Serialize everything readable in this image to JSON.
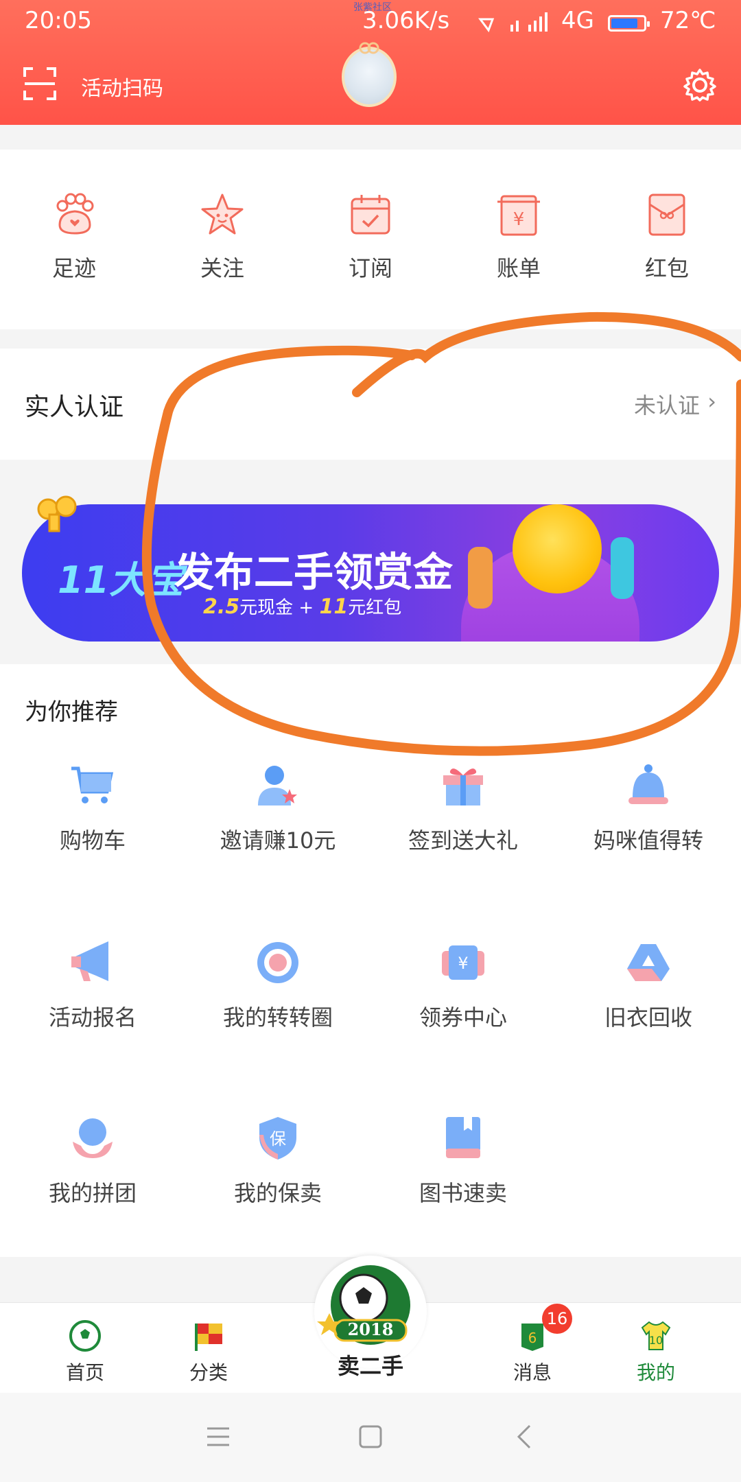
{
  "status_bar": {
    "time": "20:05",
    "speed": "3.06K/s",
    "network": "4G",
    "battery_temp": "72℃",
    "carrier_note": "张紫社区"
  },
  "header": {
    "scan_label": "活动扫码",
    "scan_icon": "scan-icon",
    "settings_icon": "gear-icon"
  },
  "shortcuts": [
    {
      "label": "足迹",
      "icon": "paw-icon"
    },
    {
      "label": "关注",
      "icon": "star-icon"
    },
    {
      "label": "订阅",
      "icon": "calendar-icon"
    },
    {
      "label": "账单",
      "icon": "bill-icon"
    },
    {
      "label": "红包",
      "icon": "red-envelope-icon"
    }
  ],
  "verify": {
    "title": "实人认证",
    "status": "未认证",
    "chevron": "›"
  },
  "banner": {
    "brand": "11大宝",
    "title": "发布二手领赏金",
    "sub_cash_amount": "2.5",
    "sub_cash_text": "元现金 +",
    "sub_red_amount": "11",
    "sub_red_text": "元红包"
  },
  "recommend": {
    "title": "为你推荐",
    "items": [
      {
        "label": "购物车",
        "icon": "cart-icon"
      },
      {
        "label": "邀请赚10元",
        "icon": "invite-icon"
      },
      {
        "label": "签到送大礼",
        "icon": "gift-icon"
      },
      {
        "label": "妈咪值得转",
        "icon": "baby-hat-icon"
      },
      {
        "label": "活动报名",
        "icon": "megaphone-icon"
      },
      {
        "label": "我的转转圈",
        "icon": "circle-icon"
      },
      {
        "label": "领券中心",
        "icon": "coupon-icon"
      },
      {
        "label": "旧衣回收",
        "icon": "recycle-icon"
      },
      {
        "label": "我的拼团",
        "icon": "group-icon"
      },
      {
        "label": "我的保卖",
        "icon": "shield-icon"
      },
      {
        "label": "图书速卖",
        "icon": "book-icon"
      }
    ]
  },
  "tabbar": {
    "tabs": [
      {
        "label": "首页",
        "icon": "soccer-ball-icon"
      },
      {
        "label": "分类",
        "icon": "flag-icon"
      },
      {
        "label": "消息",
        "icon": "message-jersey-icon"
      },
      {
        "label": "我的",
        "icon": "jersey-icon"
      }
    ],
    "center_label": "卖二手",
    "center_year": "2018",
    "badge_count": "16",
    "active_color": "#1f8a3a"
  },
  "colors": {
    "header": "#ff5348",
    "accent": "#f26b5b",
    "annotation": "#f07a2a"
  }
}
